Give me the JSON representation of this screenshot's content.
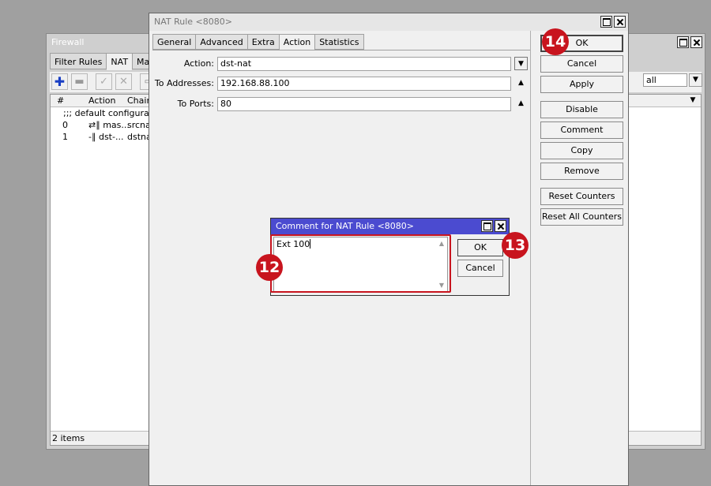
{
  "firewall": {
    "title": "Firewall",
    "tabs": [
      {
        "label": "Filter Rules",
        "active": false
      },
      {
        "label": "NAT",
        "active": true
      },
      {
        "label": "Man",
        "active": false
      }
    ],
    "filter_value": "all",
    "columns": [
      "#",
      "Action",
      "Chain"
    ],
    "section_comment": ";;; default configuration",
    "rows": [
      {
        "num": "0",
        "action": "⇄∥ mas...",
        "chain": "srcnat"
      },
      {
        "num": "1",
        "action": "-∥ dst-...",
        "chain": "dstnat"
      }
    ],
    "status": "2 items"
  },
  "nat_rule": {
    "title": "NAT Rule <8080>",
    "tabs": [
      {
        "label": "General",
        "active": false
      },
      {
        "label": "Advanced",
        "active": false
      },
      {
        "label": "Extra",
        "active": false
      },
      {
        "label": "Action",
        "active": true
      },
      {
        "label": "Statistics",
        "active": false
      }
    ],
    "fields": {
      "action": {
        "label": "Action:",
        "value": "dst-nat"
      },
      "to_addresses": {
        "label": "To Addresses:",
        "value": "192.168.88.100"
      },
      "to_ports": {
        "label": "To Ports:",
        "value": "80"
      }
    },
    "buttons": {
      "ok": "OK",
      "cancel": "Cancel",
      "apply": "Apply",
      "disable": "Disable",
      "comment": "Comment",
      "copy": "Copy",
      "remove": "Remove",
      "reset_counters": "Reset Counters",
      "reset_all_counters": "Reset All Counters"
    }
  },
  "comment_dialog": {
    "title": "Comment for NAT Rule <8080>",
    "text": "Ext 100",
    "ok": "OK",
    "cancel": "Cancel"
  },
  "annotations": {
    "step_12": "12",
    "step_13": "13",
    "step_14": "14",
    "highlight_color": "#c8141e"
  },
  "colors": {
    "dialog_titlebar": "#4b4bd0",
    "desktop": "#a0a0a0"
  }
}
